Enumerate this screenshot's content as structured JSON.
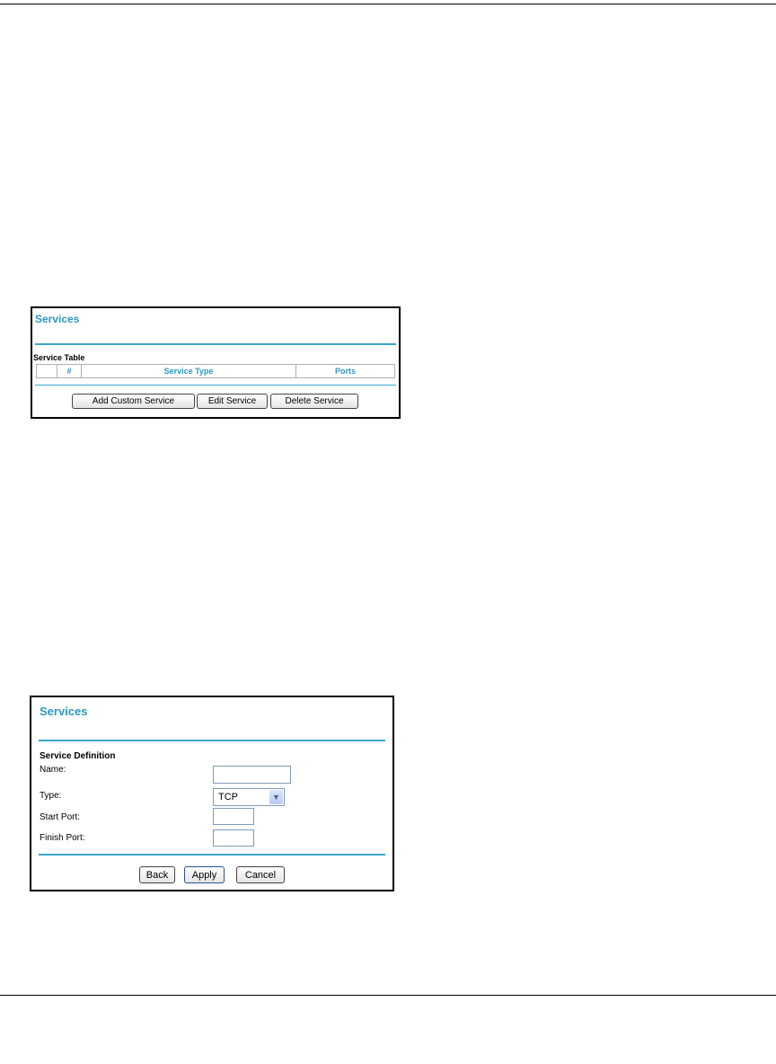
{
  "services_list": {
    "title": "Services",
    "section_label": "Service Table",
    "columns": [
      "",
      "#",
      "Service Type",
      "Ports"
    ],
    "buttons": {
      "add": "Add Custom Service",
      "edit": "Edit Service",
      "delete": "Delete Service"
    }
  },
  "service_form": {
    "title": "Services",
    "section_label": "Service Definition",
    "labels": {
      "name": "Name:",
      "type": "Type:",
      "start_port": "Start Port:",
      "finish_port": "Finish Port:"
    },
    "values": {
      "name": "",
      "type": "TCP",
      "start_port": "",
      "finish_port": ""
    },
    "buttons": {
      "back": "Back",
      "apply": "Apply",
      "cancel": "Cancel"
    }
  },
  "colors": {
    "accent": "#2a98c2"
  }
}
